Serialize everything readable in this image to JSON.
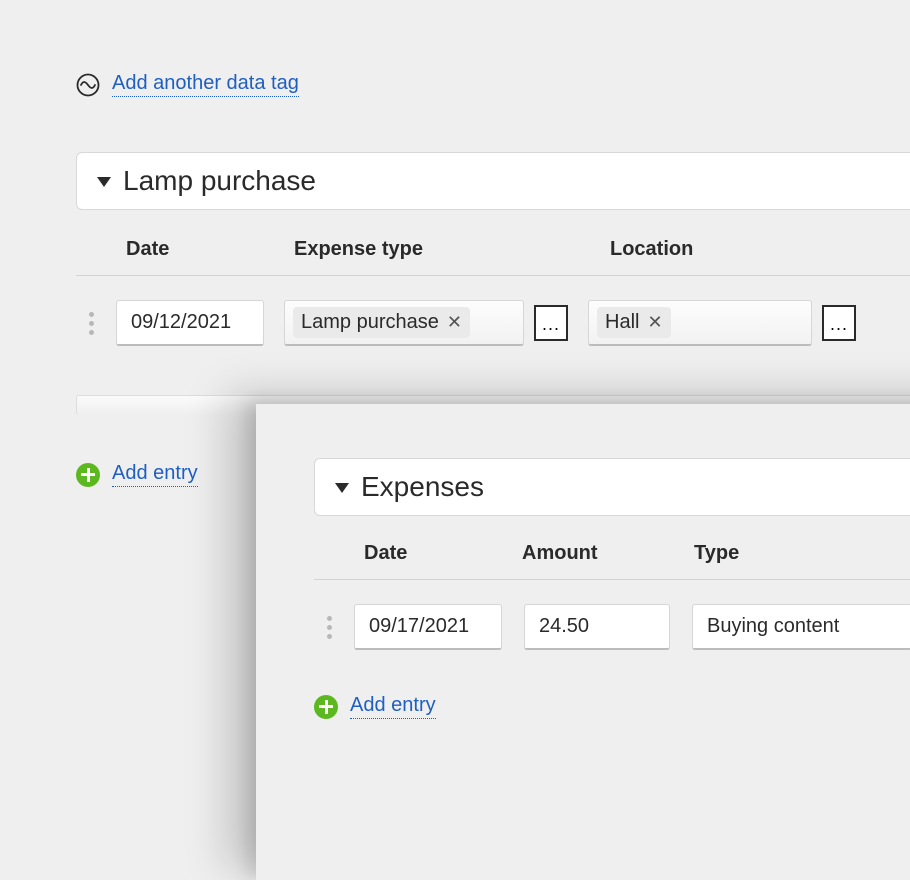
{
  "top_link": "Add another data tag",
  "panel1": {
    "title": "Lamp purchase",
    "headers": {
      "date": "Date",
      "expense_type": "Expense type",
      "location": "Location"
    },
    "row": {
      "date": "09/12/2021",
      "expense_type_chip": "Lamp purchase",
      "location_chip": "Hall",
      "more": "..."
    }
  },
  "add_entry_label": "Add entry",
  "panel2": {
    "title": "Expenses",
    "headers": {
      "date": "Date",
      "amount": "Amount",
      "type": "Type"
    },
    "row": {
      "date": "09/17/2021",
      "amount": "24.50",
      "type": "Buying content"
    }
  }
}
